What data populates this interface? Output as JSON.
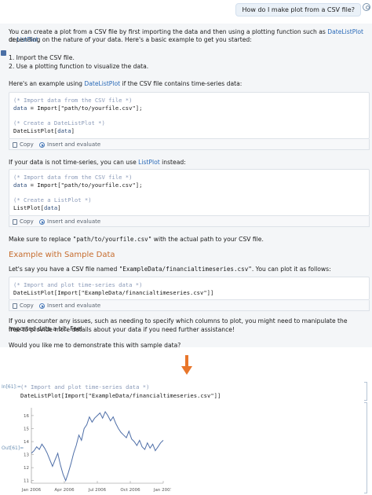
{
  "user_message": "How do I make plot from a CSV file?",
  "answer": {
    "intro_a": "You can create a plot from a CSV file by first importing the data and then using a plotting function such as ",
    "intro_link1": "DateListPlot",
    "intro_or": " or ",
    "intro_link2": "ListPlot",
    "intro_b": ",",
    "intro_line2": "depending on the nature of your data. Here's a basic example to get you started:",
    "step1": "1. Import the CSV file.",
    "step2": "2. Use a plotting function to visualize the data.",
    "example_a": "Here's an example using ",
    "example_link": "DateListPlot",
    "example_b": " if the CSV file contains time-series data:",
    "notime_a": "If your data is not time-series, you can use ",
    "notime_link": "ListPlot",
    "notime_b": " instead:",
    "replace_a": "Make sure to replace ",
    "replace_code": "\"path/to/yourfile.csv\"",
    "replace_b": " with the actual path to your CSV file.",
    "section_title": "Example with Sample Data",
    "sample_a": "Let's say you have a CSV file named ",
    "sample_code": "\"ExampleData/financialtimeseries.csv\"",
    "sample_b": ". You can plot it as follows:",
    "issues_line1": "If you encounter any issues, such as needing to specify which columns to plot, you might need to manipulate the imported data a bit. Feel",
    "issues_line2": "free to provide more details about your data if you need further assistance!",
    "closing": "Would you like me to demonstrate this with sample data?"
  },
  "code_blocks": {
    "block1": {
      "c1": "(* Import data from the CSV file *)",
      "v1": "data",
      "a1": " = Import[\"path/to/yourfile.csv\"];",
      "c2": "(* Create a DateListPlot *)",
      "f2": "DateListPlot[",
      "v2": "data",
      "e2": "]"
    },
    "block2": {
      "c1": "(* Import data from the CSV file *)",
      "v1": "data",
      "a1": " = Import[\"path/to/yourfile.csv\"];",
      "c2": "(* Create a ListPlot *)",
      "f2": "ListPlot[",
      "v2": "data",
      "e2": "]"
    },
    "block3": {
      "c1": "(* Import and plot time-series data *)",
      "l2": "DateListPlot[Import[\"ExampleData/financialtimeseries.csv\"]]"
    },
    "copy_label": "Copy",
    "evaluate_label": "Insert and evaluate"
  },
  "notebook": {
    "in_label": "In[61]:=",
    "out_label": "Out[61]=",
    "comment": "(* Import and plot time-series data *)",
    "code": "DateListPlot[Import[\"ExampleData/financialtimeseries.csv\"]]"
  },
  "colors": {
    "accent": "#e8762b",
    "link": "#2a6ab8",
    "section": "#c66c2d",
    "series": "#4f6fa8"
  },
  "chart_data": {
    "type": "line",
    "x_ticks": [
      "Jan 2006",
      "Apr 2006",
      "Jul 2006",
      "Oct 2006",
      "Jan 2007"
    ],
    "y_ticks": [
      11,
      12,
      13,
      14,
      15,
      16
    ],
    "ylim": [
      10.8,
      16.6
    ],
    "xlabel": "",
    "ylabel": "",
    "grid": false,
    "series": [
      {
        "x": [
          0,
          0.02,
          0.04,
          0.06,
          0.08,
          0.1,
          0.12,
          0.14,
          0.16,
          0.18,
          0.2,
          0.22,
          0.24,
          0.26,
          0.28,
          0.3,
          0.32,
          0.34,
          0.36,
          0.38,
          0.4,
          0.42,
          0.44,
          0.46,
          0.48,
          0.5,
          0.52,
          0.54,
          0.56,
          0.58,
          0.6,
          0.62,
          0.64,
          0.66,
          0.68,
          0.7,
          0.72,
          0.74,
          0.76,
          0.78,
          0.8,
          0.82,
          0.84,
          0.86,
          0.88,
          0.9,
          0.92,
          0.94,
          0.96,
          0.98,
          1.0
        ],
        "values": [
          13.1,
          13.3,
          13.6,
          13.4,
          13.8,
          13.5,
          13.1,
          12.6,
          12.1,
          12.6,
          13.1,
          12.2,
          11.5,
          11.0,
          11.6,
          12.3,
          13.1,
          13.7,
          14.5,
          14.1,
          15.0,
          15.3,
          15.9,
          15.5,
          15.8,
          16.0,
          16.2,
          15.8,
          16.3,
          16.0,
          15.6,
          15.9,
          15.4,
          15.0,
          14.7,
          14.5,
          14.3,
          14.8,
          14.2,
          14.0,
          13.7,
          14.1,
          13.6,
          13.4,
          13.9,
          13.5,
          13.8,
          13.3,
          13.6,
          13.9,
          14.1
        ]
      }
    ]
  }
}
